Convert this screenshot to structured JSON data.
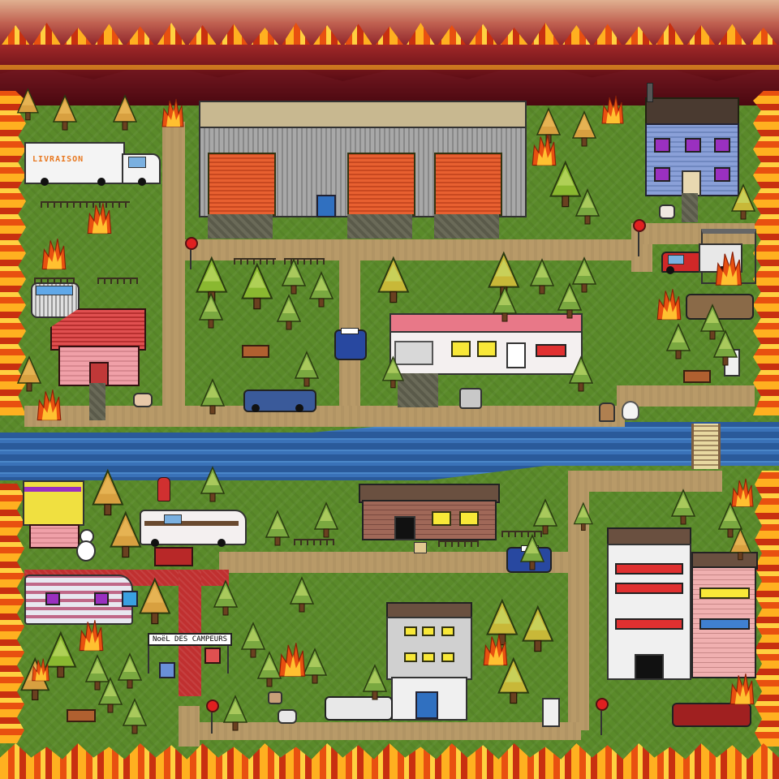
{
  "scene": "town-map-on-fire",
  "labels": {
    "truck_sign": "LIVRAISON",
    "banner_text": "NoëL DES CAMPEURS"
  },
  "colors": {
    "grass": "#5a8a2a",
    "path": "#b89a68",
    "river": "#3a72b8",
    "fire": "#ffb020",
    "sky_smoke": "#8a2028"
  },
  "icons": [
    "fire-icon",
    "pine-tree-icon",
    "stop-sign-icon",
    "bench-icon",
    "gift-icon",
    "cat-icon",
    "dog-icon",
    "snowman-icon",
    "ghost-icon",
    "phone-booth-icon"
  ]
}
